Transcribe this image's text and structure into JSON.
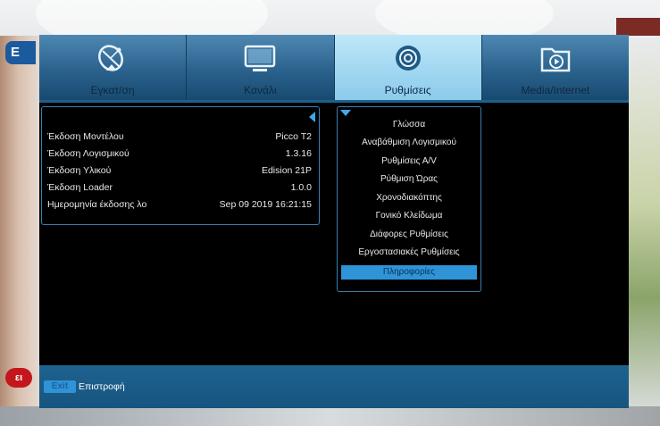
{
  "tabs": [
    {
      "label": "Εγκατ/ση",
      "icon": "satellite-dish-icon",
      "active": false
    },
    {
      "label": "Κανάλι",
      "icon": "tv-icon",
      "active": false
    },
    {
      "label": "Ρυθμίσεις",
      "icon": "settings-icon",
      "active": true
    },
    {
      "label": "Media/Internet",
      "icon": "media-folder-icon",
      "active": false
    }
  ],
  "info": {
    "rows": [
      {
        "key": "Έκδοση Μοντέλου",
        "value": "Picco T2"
      },
      {
        "key": "Έκδοση Λογισμικού",
        "value": "1.3.16"
      },
      {
        "key": "Έκδοση Υλικού",
        "value": "Edision 21P"
      },
      {
        "key": "Έκδοση Loader",
        "value": "1.0.0"
      },
      {
        "key": "Ημερομηνία έκδοσης λο",
        "value": "Sep 09 2019 16:21:15"
      }
    ]
  },
  "submenu": {
    "items": [
      {
        "label": "Γλώσσα",
        "selected": false
      },
      {
        "label": "Αναβάθμιση Λογισμικού",
        "selected": false
      },
      {
        "label": "Ρυθμίσεις Α/V",
        "selected": false
      },
      {
        "label": "Ρύθμιση Ώρας",
        "selected": false
      },
      {
        "label": "Χρονοδιακόπτης",
        "selected": false
      },
      {
        "label": "Γονικό Κλείδωμα",
        "selected": false
      },
      {
        "label": "Διάφορες Ρυθμίσεις",
        "selected": false
      },
      {
        "label": "Εργοστασιακές Ρυθμίσεις",
        "selected": false
      },
      {
        "label": "Πληροφορίες",
        "selected": true
      }
    ]
  },
  "footer": {
    "key_label": "Exit",
    "action_label": "Επιστροφή"
  },
  "background": {
    "channel_logo_top": "E",
    "channel_logo_bottom": "ει"
  },
  "colors": {
    "tab_active": "#9fd6f0",
    "tab_inactive": "#2a628d",
    "panel_border": "#3a7fb0",
    "selection": "#2f93d8",
    "footer": "#1a5b88"
  }
}
